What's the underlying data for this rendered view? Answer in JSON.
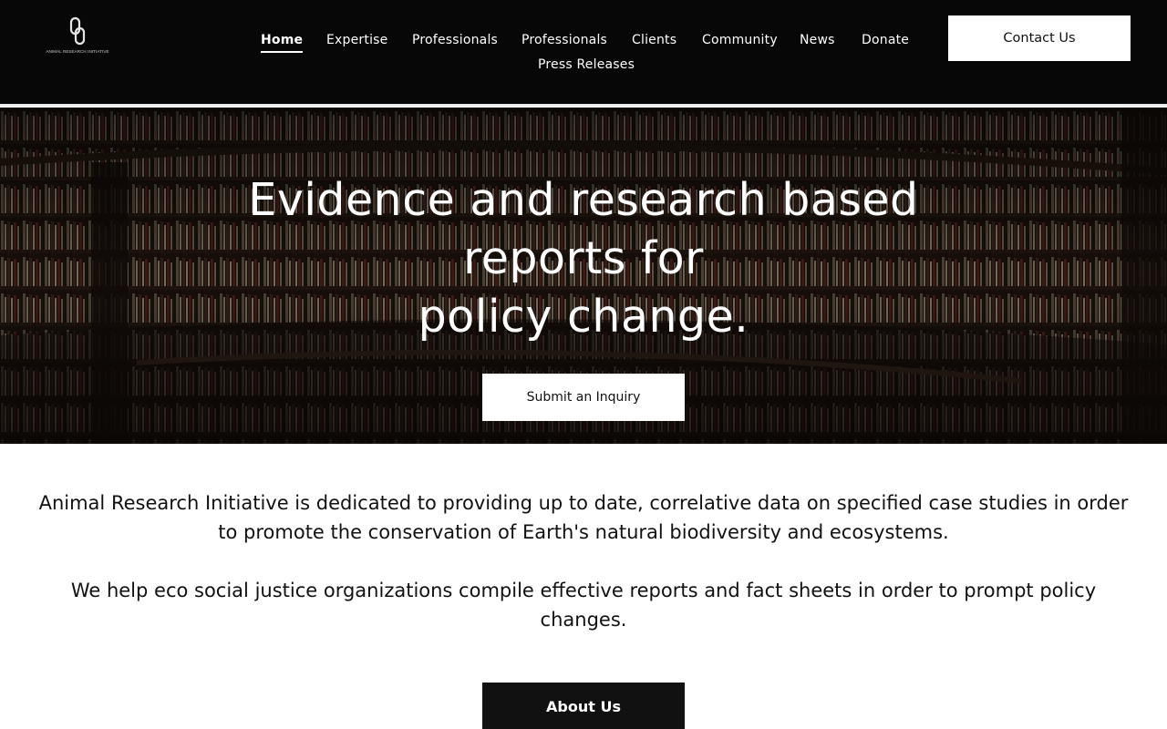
{
  "brand": {
    "logo_text": "ANIMAL RESEARCH INITIATIVE"
  },
  "nav": {
    "items": [
      {
        "label": "Home",
        "active": true
      },
      {
        "label": "Expertise"
      },
      {
        "label": "Professionals"
      },
      {
        "label": "Professionals"
      },
      {
        "label": "Clients"
      },
      {
        "label": "Community"
      },
      {
        "label": "News"
      },
      {
        "label": "Donate"
      },
      {
        "label": "Press Releases"
      }
    ],
    "contact_label": "Contact Us"
  },
  "hero": {
    "title_lines": [
      "Evidence and research based",
      "reports for",
      "policy change."
    ],
    "cta_label": "Submit an Inquiry"
  },
  "intro": {
    "paragraph_1": "Animal Research Initiative is dedicated to providing up to date, correlative data on specified case studies in order to promote the conservation of Earth's natural biodiversity and ecosystems.",
    "paragraph_2": "We help eco social justice organizations compile effective reports and fact sheets in order to prompt policy changes.",
    "about_label": "About Us"
  },
  "colors": {
    "header_bg": "#070707",
    "button_dark": "#111111",
    "button_light": "#ffffff"
  },
  "icons": {
    "logo": "chain-link-logo-icon"
  }
}
